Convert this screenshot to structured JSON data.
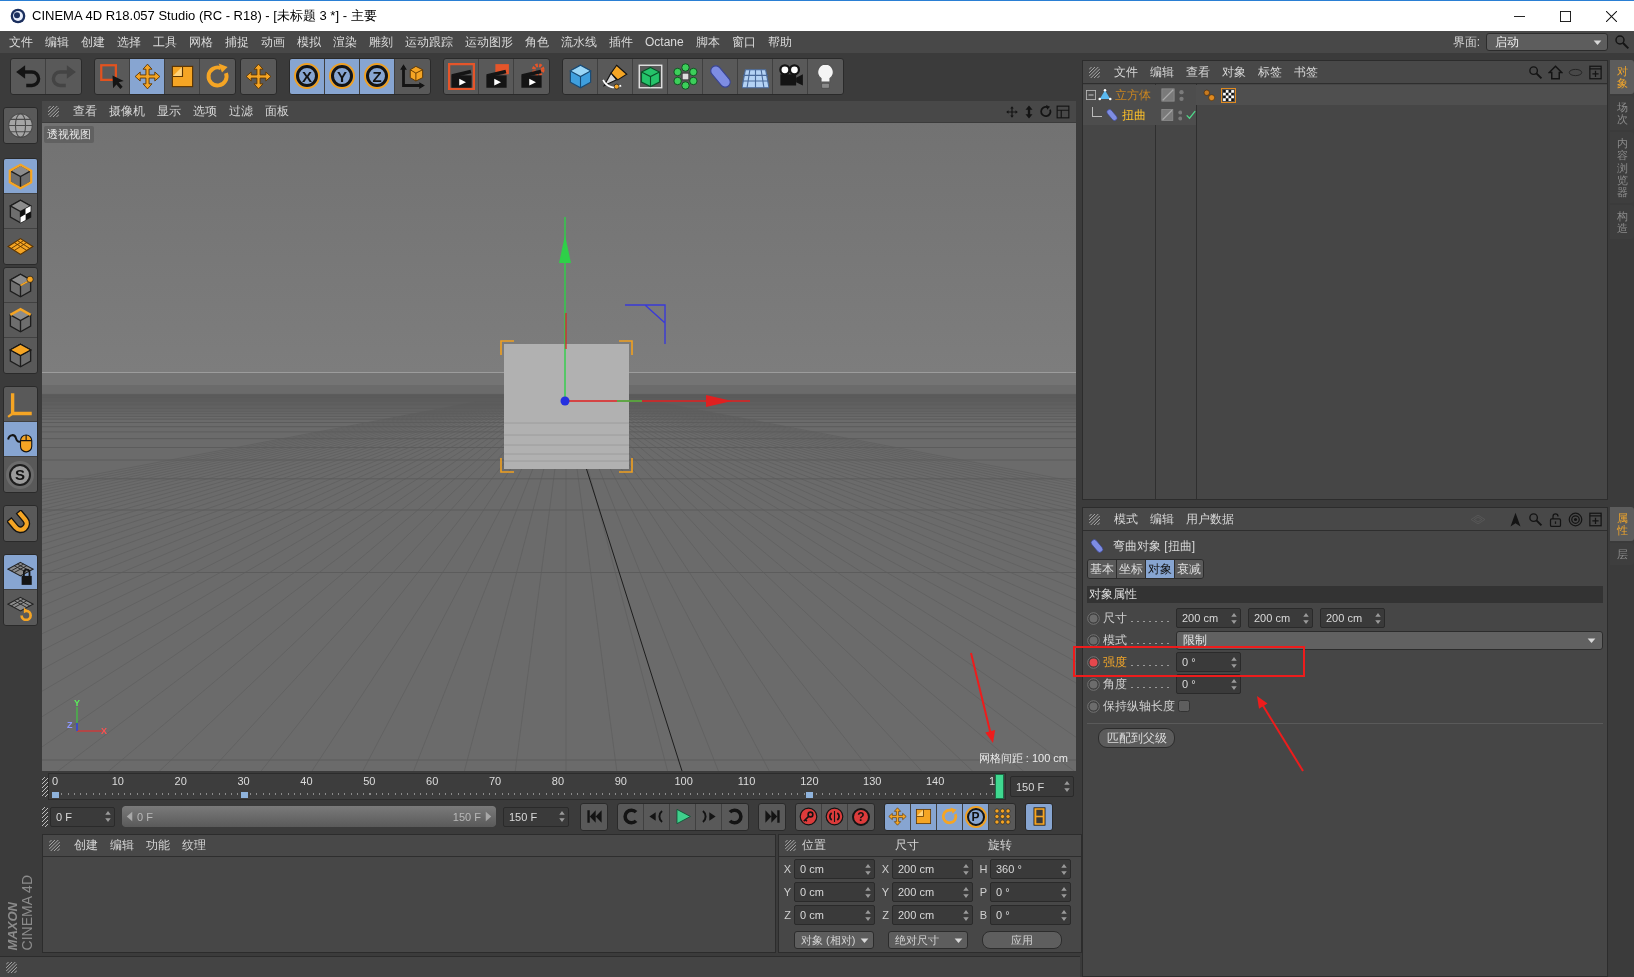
{
  "window": {
    "title": "CINEMA 4D R18.057 Studio (RC - R18) - [未标题 3 *] - 主要"
  },
  "menu": [
    "文件",
    "编辑",
    "创建",
    "选择",
    "工具",
    "网格",
    "捕捉",
    "动画",
    "模拟",
    "渲染",
    "雕刻",
    "运动跟踪",
    "运动图形",
    "角色",
    "流水线",
    "插件",
    "Octane",
    "脚本",
    "窗口",
    "帮助"
  ],
  "layout_picker": {
    "label": "界面:",
    "value": "启动"
  },
  "toolbar": [
    [
      {
        "kind": "undo",
        "selected": false,
        "disabled": false
      },
      {
        "kind": "redo",
        "selected": false,
        "disabled": true
      }
    ],
    [
      {
        "kind": "select",
        "selected": false,
        "disabled": false
      },
      {
        "kind": "move",
        "selected": true,
        "disabled": false
      },
      {
        "kind": "scale",
        "selected": false,
        "disabled": false
      },
      {
        "kind": "rotate",
        "selected": false,
        "disabled": false
      }
    ],
    [
      {
        "kind": "recent",
        "selected": false,
        "disabled": false
      }
    ],
    [
      {
        "kind": "axis",
        "label": "X",
        "selected": true,
        "disabled": false
      },
      {
        "kind": "axis",
        "label": "Y",
        "selected": true,
        "disabled": false
      },
      {
        "kind": "axis",
        "label": "Z",
        "selected": true,
        "disabled": false
      },
      {
        "kind": "coords",
        "selected": false,
        "disabled": false
      }
    ],
    [
      {
        "kind": "render_view",
        "selected": false,
        "disabled": false
      },
      {
        "kind": "render_viewer",
        "selected": false,
        "disabled": false
      },
      {
        "kind": "render_settings",
        "selected": false,
        "disabled": false
      }
    ],
    [
      {
        "kind": "cube",
        "selected": false,
        "disabled": false
      },
      {
        "kind": "pen",
        "selected": false,
        "disabled": false
      },
      {
        "kind": "subdivision",
        "selected": false,
        "disabled": false
      },
      {
        "kind": "cloner",
        "selected": false,
        "disabled": false
      },
      {
        "kind": "bend",
        "selected": false,
        "disabled": false
      },
      {
        "kind": "floor",
        "selected": false,
        "disabled": false
      },
      {
        "kind": "camera",
        "selected": false,
        "disabled": false
      },
      {
        "kind": "light",
        "selected": false,
        "disabled": false
      }
    ]
  ],
  "tools": [
    [
      {
        "kind": "make_editable",
        "selected": false
      }
    ],
    [
      {
        "kind": "model",
        "selected": true
      },
      {
        "kind": "texture",
        "selected": false
      },
      {
        "kind": "workplane",
        "selected": false
      }
    ],
    [
      {
        "kind": "points",
        "selected": false
      },
      {
        "kind": "edges",
        "selected": false
      },
      {
        "kind": "polygons",
        "selected": false
      }
    ],
    [
      {
        "kind": "axis_mode",
        "selected": false
      },
      {
        "kind": "tweak",
        "selected": true
      },
      {
        "kind": "snap",
        "label": "S",
        "selected": false
      }
    ],
    [
      {
        "kind": "magnet",
        "selected": false
      }
    ],
    [
      {
        "kind": "lock_workplane",
        "selected": true
      },
      {
        "kind": "align_workplane",
        "selected": false
      }
    ]
  ],
  "logo": {
    "brand": "MAXON",
    "product": "CINEMA 4D"
  },
  "viewport": {
    "menu": [
      "查看",
      "摄像机",
      "显示",
      "选项",
      "过滤",
      "面板"
    ],
    "label": "透视视图",
    "axes": [
      "Y",
      "Z",
      "X"
    ],
    "grid_spacing": "网格间距 : 100 cm"
  },
  "timeline": {
    "ticks": [
      "0",
      "10",
      "20",
      "30",
      "40",
      "50",
      "60",
      "70",
      "80",
      "90",
      "100",
      "110",
      "120",
      "130",
      "140",
      "1"
    ],
    "keys": [
      {
        "level": 0
      },
      {
        "level": 0.2
      },
      {
        "level": 0.8
      }
    ],
    "playhead": {
      "level": 1
    },
    "end": "150 F"
  },
  "playback": {
    "current": "0 F",
    "range": {
      "from": "0 F",
      "to": "150 F",
      "level": 1
    },
    "end": "150 F",
    "buttons": [
      [
        {
          "kind": "first",
          "selected": false
        }
      ],
      [
        {
          "kind": "prev_key",
          "selected": false
        },
        {
          "kind": "prev_frame",
          "selected": false
        },
        {
          "kind": "play",
          "selected": false
        },
        {
          "kind": "next_frame",
          "selected": false
        },
        {
          "kind": "next_key",
          "selected": false
        }
      ],
      [
        {
          "kind": "last",
          "selected": false
        }
      ],
      [
        {
          "kind": "record",
          "selected": false
        },
        {
          "kind": "autokey",
          "selected": false
        },
        {
          "kind": "keyset",
          "label": "?",
          "selected": false
        }
      ],
      [
        {
          "kind": "move",
          "selected": true
        },
        {
          "kind": "scale",
          "selected": true
        },
        {
          "kind": "rotate",
          "selected": true
        },
        {
          "kind": "param",
          "label": "P",
          "selected": true
        },
        {
          "kind": "point_level",
          "selected": false
        }
      ],
      [
        {
          "kind": "timeline",
          "selected": true
        }
      ]
    ]
  },
  "materials": {
    "menu": [
      "创建",
      "编辑",
      "功能",
      "纹理"
    ]
  },
  "coordinates": {
    "headers": [
      "位置",
      "尺寸",
      "旋转"
    ],
    "rows": [
      [
        {
          "axis": "X",
          "value": "0 cm"
        },
        {
          "axis": "X",
          "value": "200 cm"
        },
        {
          "axis": "H",
          "value": "360 °"
        }
      ],
      [
        {
          "axis": "Y",
          "value": "0 cm"
        },
        {
          "axis": "Y",
          "value": "200 cm"
        },
        {
          "axis": "P",
          "value": "0 °"
        }
      ],
      [
        {
          "axis": "Z",
          "value": "0 cm"
        },
        {
          "axis": "Z",
          "value": "200 cm"
        },
        {
          "axis": "B",
          "value": "0 °"
        }
      ]
    ],
    "modes": [
      "对象 (相对)",
      "绝对尺寸"
    ],
    "apply": "应用"
  },
  "objects": {
    "menu": [
      "文件",
      "编辑",
      "查看",
      "对象",
      "标签",
      "书签"
    ],
    "tree": [
      {
        "name": "立方体",
        "kind": "polygon",
        "selected": true,
        "active": false,
        "expanded": true,
        "enabled": false,
        "tags": [
          {
            "kind": "phong",
            "selected": false
          },
          {
            "kind": "uvw",
            "selected": true
          }
        ],
        "children": [
          {
            "name": "扭曲",
            "kind": "deformer",
            "selected": true,
            "active": true,
            "enabled": true
          }
        ]
      }
    ],
    "side_tabs": [
      {
        "label": "对象",
        "selected": true
      },
      {
        "label": "场次",
        "selected": false
      },
      {
        "label": "内容浏览器",
        "selected": false
      },
      {
        "label": "构造",
        "selected": false
      }
    ]
  },
  "attributes": {
    "menu": [
      "模式",
      "编辑",
      "用户数据"
    ],
    "title": "弯曲对象 [扭曲]",
    "tabs": [
      {
        "label": "基本",
        "selected": false
      },
      {
        "label": "坐标",
        "selected": false
      },
      {
        "label": "对象",
        "selected": true
      },
      {
        "label": "衰减",
        "selected": false
      }
    ],
    "section": "对象属性",
    "props": [
      {
        "kind": "vector",
        "label": "尺寸",
        "values": [
          "200 cm",
          "200 cm",
          "200 cm"
        ],
        "keyframe": false
      },
      {
        "kind": "dropdown",
        "label": "模式",
        "value": "限制",
        "keyframe": false
      },
      {
        "kind": "number",
        "label": "强度",
        "value": "0 °",
        "keyframe": true
      },
      {
        "kind": "number",
        "label": "角度",
        "value": "0 °",
        "keyframe": false
      },
      {
        "kind": "checkbox",
        "label": "保持纵轴长度",
        "checked": false,
        "keyframe": false
      }
    ],
    "button": "匹配到父级",
    "side_tabs": [
      {
        "label": "属性",
        "selected": true
      },
      {
        "label": "层",
        "selected": false
      }
    ]
  }
}
